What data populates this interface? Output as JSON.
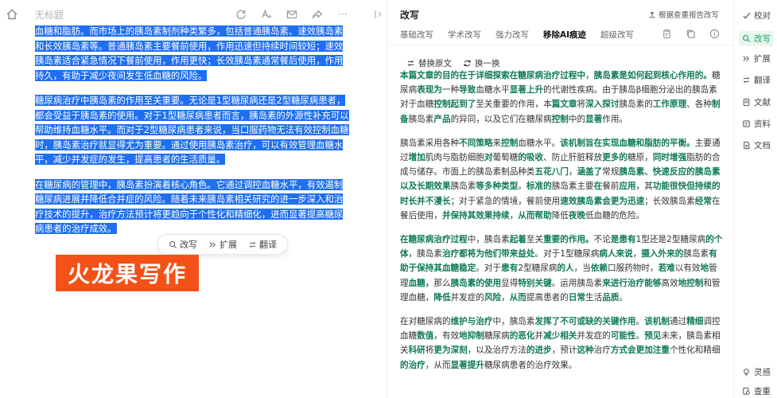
{
  "editor": {
    "title": "无标题",
    "tools": [
      "refresh-icon",
      "font-size-icon",
      "mail-icon",
      "share-icon",
      "more-icon",
      "collapse-icon"
    ],
    "more_label": "···",
    "paragraphs": [
      {
        "segments": [
          "血糖和脂肪。而市场上的胰岛素制剂种类繁多，包括普通胰岛素、速效胰岛素和长效胰岛素等。普通胰岛素主要餐前使用，作用迅速但持续时间较短；速效胰岛素适合紧急情况下餐前使用，作用更快；长效胰岛素通常餐后使用，作用持久，有助于减少夜间发生低血糖的风险。"
        ]
      },
      {
        "segments": [
          "糖尿病治疗中胰岛素的作用至关重要。无论是1型糖尿病还是2型糖尿病患者，都会受益于胰岛素的使用。对于1型糖尿病患者而言，胰岛素的外源性补充可以帮助维持血糖水平。而对于2型糖尿病患者来说，当口服药物无法有效控制血糖时，胰岛素治疗就显得尤为重要。通过使用胰岛素治疗，可以有效管理血糖水平，减少并发症的发生，提高患者的生活质量。"
        ]
      },
      {
        "segments": [
          "在糖尿病的管理中，胰岛素扮演着核心角色。它通过调控血糖水平，有效遏制糖尿病进展并降低合并症的风险。随着未来胰岛素相关研究的进一步深入和治疗技术的提升，治疗方法预计将更趋向于个性化和精细化，进而显著提高糖尿病患者的治疗成效。"
        ]
      }
    ],
    "float_actions": [
      {
        "icon": "rewrite-icon",
        "label": "改写"
      },
      {
        "icon": "expand-icon",
        "label": "扩展"
      },
      {
        "icon": "translate-icon",
        "label": "翻译"
      }
    ],
    "brand_label": "火龙果写作"
  },
  "panel": {
    "title": "改写",
    "report_label": "根据查重报告改写",
    "tabs": [
      {
        "label": "基础改写",
        "active": false
      },
      {
        "label": "学术改写",
        "active": false
      },
      {
        "label": "强力改写",
        "active": false
      },
      {
        "label": "移除AI痕迹",
        "active": true
      },
      {
        "label": "超级改写",
        "active": false
      }
    ],
    "tool_icons": [
      "clipboard-icon",
      "copy-icon",
      "info-icon"
    ],
    "swap_buttons": [
      {
        "icon": "replace-icon",
        "label": "替换原文"
      },
      {
        "icon": "swap-batch-icon",
        "label": "换一换"
      }
    ],
    "paragraphs": [
      {
        "segments": [
          {
            "t": "本篇文章的目的在于详细探索在糖尿病治疗过程中",
            "g": true
          },
          {
            "t": "，",
            "g": false
          },
          {
            "t": "胰岛素是如何起到核心作用的。",
            "g": true
          },
          {
            "t": "糖尿病",
            "g": false
          },
          {
            "t": "表现为",
            "g": true
          },
          {
            "t": "一种",
            "g": false
          },
          {
            "t": "导致",
            "g": true
          },
          {
            "t": "血糖水平",
            "g": false
          },
          {
            "t": "显著上升",
            "g": true
          },
          {
            "t": "的代谢性疾病。由于胰岛β细胞分泌出的胰岛素对于血糖",
            "g": false
          },
          {
            "t": "控制起到了",
            "g": true
          },
          {
            "t": "至关重要的作用，本",
            "g": false
          },
          {
            "t": "篇文章",
            "g": true
          },
          {
            "t": "将",
            "g": false
          },
          {
            "t": "深入探讨",
            "g": true
          },
          {
            "t": "胰岛素的",
            "g": false
          },
          {
            "t": "工作原理",
            "g": true
          },
          {
            "t": "、各种",
            "g": false
          },
          {
            "t": "制备",
            "g": true
          },
          {
            "t": "胰岛素",
            "g": false
          },
          {
            "t": "产品",
            "g": true
          },
          {
            "t": "的异同，以及它们在糖尿病",
            "g": false
          },
          {
            "t": "控制",
            "g": true
          },
          {
            "t": "中的",
            "g": false
          },
          {
            "t": "显著",
            "g": true
          },
          {
            "t": "作用。",
            "g": false
          }
        ]
      },
      {
        "segments": [
          {
            "t": "胰岛素采用各种",
            "g": false
          },
          {
            "t": "不同策略",
            "g": true
          },
          {
            "t": "来",
            "g": false
          },
          {
            "t": "控制",
            "g": true
          },
          {
            "t": "血糖水平。",
            "g": false
          },
          {
            "t": "该机制旨在实现血糖和脂肪的平衡。",
            "g": true
          },
          {
            "t": "主要通过",
            "g": false
          },
          {
            "t": "增加",
            "g": true
          },
          {
            "t": "肌肉与脂肪细胞",
            "g": false
          },
          {
            "t": "对",
            "g": true
          },
          {
            "t": "葡萄糖",
            "g": false
          },
          {
            "t": "的吸收",
            "g": true
          },
          {
            "t": "、防止肝脏释放",
            "g": false
          },
          {
            "t": "更多的",
            "g": true
          },
          {
            "t": "糖原，",
            "g": false
          },
          {
            "t": "同时增强",
            "g": true
          },
          {
            "t": "脂肪的合成与储存。市面上的胰岛素制品种类",
            "g": false
          },
          {
            "t": "五花八门",
            "g": true
          },
          {
            "t": "，",
            "g": false
          },
          {
            "t": "涵盖了",
            "g": true
          },
          {
            "t": "常规",
            "g": false
          },
          {
            "t": "胰岛素、快速反应的胰岛素以及长期效果",
            "g": true
          },
          {
            "t": "胰岛素",
            "g": false
          },
          {
            "t": "等多种类型",
            "g": true
          },
          {
            "t": "。",
            "g": false
          },
          {
            "t": "标准的",
            "g": true
          },
          {
            "t": "胰岛素主要",
            "g": false
          },
          {
            "t": "在",
            "g": true
          },
          {
            "t": "餐前",
            "g": false
          },
          {
            "t": "应用",
            "g": true
          },
          {
            "t": "，其",
            "g": false
          },
          {
            "t": "功能很快但持续的时长并不漫长",
            "g": true
          },
          {
            "t": "；对于紧急的情境，餐前使用",
            "g": false
          },
          {
            "t": "速效胰岛素会更为迅速",
            "g": true
          },
          {
            "t": "；长效胰岛素",
            "g": false
          },
          {
            "t": "经常",
            "g": true
          },
          {
            "t": "在餐后使用，",
            "g": false
          },
          {
            "t": "并保持其效果持续",
            "g": true
          },
          {
            "t": "，",
            "g": false
          },
          {
            "t": "从而帮助",
            "g": true
          },
          {
            "t": "降低",
            "g": false
          },
          {
            "t": "夜晚",
            "g": true
          },
          {
            "t": "低血糖的危险。",
            "g": false
          }
        ]
      },
      {
        "segments": [
          {
            "t": "在糖尿病治疗过程",
            "g": true
          },
          {
            "t": "中，胰岛素",
            "g": false
          },
          {
            "t": "起着",
            "g": true
          },
          {
            "t": "至关",
            "g": false
          },
          {
            "t": "重要的作用。",
            "g": true
          },
          {
            "t": "不论",
            "g": false
          },
          {
            "t": "是患有",
            "g": true
          },
          {
            "t": "1型还是2型糖尿病",
            "g": false
          },
          {
            "t": "的个体",
            "g": true
          },
          {
            "t": "，胰岛素",
            "g": false
          },
          {
            "t": "治疗都将为他们带来益处",
            "g": true
          },
          {
            "t": "。对于1型糖尿病",
            "g": false
          },
          {
            "t": "病人来说",
            "g": true
          },
          {
            "t": "，",
            "g": false
          },
          {
            "t": "摄入外来的",
            "g": true
          },
          {
            "t": "胰岛素",
            "g": false
          },
          {
            "t": "有助于保持其血糖稳定",
            "g": true
          },
          {
            "t": "。对于",
            "g": false
          },
          {
            "t": "患有",
            "g": true
          },
          {
            "t": "2型糖尿病",
            "g": false
          },
          {
            "t": "的人",
            "g": true
          },
          {
            "t": "，当",
            "g": false
          },
          {
            "t": "依赖",
            "g": true
          },
          {
            "t": "口服药物时，",
            "g": false
          },
          {
            "t": "若难",
            "g": true
          },
          {
            "t": "以有效",
            "g": false
          },
          {
            "t": "地",
            "g": true
          },
          {
            "t": "管理",
            "g": false
          },
          {
            "t": "血糖，",
            "g": true
          },
          {
            "t": "那么",
            "g": false
          },
          {
            "t": "胰岛素的使用",
            "g": true
          },
          {
            "t": "显得",
            "g": false
          },
          {
            "t": "特别关键",
            "g": true
          },
          {
            "t": "。运用胰岛素",
            "g": false
          },
          {
            "t": "来进行治疗能够",
            "g": true
          },
          {
            "t": "高效",
            "g": false
          },
          {
            "t": "地控制",
            "g": true
          },
          {
            "t": "和管理血糖，",
            "g": false
          },
          {
            "t": "降低",
            "g": true
          },
          {
            "t": "并发症的",
            "g": false
          },
          {
            "t": "风险",
            "g": true
          },
          {
            "t": "，",
            "g": false
          },
          {
            "t": "从而",
            "g": true
          },
          {
            "t": "提高患者的",
            "g": false
          },
          {
            "t": "日常",
            "g": true
          },
          {
            "t": "生活",
            "g": false
          },
          {
            "t": "品质",
            "g": true
          },
          {
            "t": "。",
            "g": false
          }
        ]
      },
      {
        "segments": [
          {
            "t": "在对糖尿病的",
            "g": false
          },
          {
            "t": "维护与治疗",
            "g": true
          },
          {
            "t": "中，胰岛素",
            "g": false
          },
          {
            "t": "发挥了不可或缺的关键作用",
            "g": true
          },
          {
            "t": "。",
            "g": false
          },
          {
            "t": "该机制",
            "g": true
          },
          {
            "t": "通过",
            "g": false
          },
          {
            "t": "精细",
            "g": true
          },
          {
            "t": "调控血糖",
            "g": false
          },
          {
            "t": "数值",
            "g": true
          },
          {
            "t": "，有效",
            "g": false
          },
          {
            "t": "地抑制",
            "g": true
          },
          {
            "t": "糖尿病",
            "g": false
          },
          {
            "t": "的恶化",
            "g": true
          },
          {
            "t": "并",
            "g": false
          },
          {
            "t": "减少相关",
            "g": true
          },
          {
            "t": "并发症的",
            "g": false
          },
          {
            "t": "可能性",
            "g": true
          },
          {
            "t": "。",
            "g": false
          },
          {
            "t": "预见",
            "g": true
          },
          {
            "t": "未来，胰岛素相关",
            "g": false
          },
          {
            "t": "科研",
            "g": true
          },
          {
            "t": "将",
            "g": false
          },
          {
            "t": "更为深刻",
            "g": true
          },
          {
            "t": "，以及治疗方法",
            "g": false
          },
          {
            "t": "的进步",
            "g": true
          },
          {
            "t": "，预计",
            "g": false
          },
          {
            "t": "这种",
            "g": true
          },
          {
            "t": "治疗",
            "g": false
          },
          {
            "t": "方式会更加注重",
            "g": true
          },
          {
            "t": "个性化和精细",
            "g": false
          },
          {
            "t": "的治疗",
            "g": true
          },
          {
            "t": "，从而",
            "g": false
          },
          {
            "t": "显著提升",
            "g": true
          },
          {
            "t": "糖尿病患者的治疗效果。",
            "g": false
          }
        ]
      }
    ]
  },
  "right_rail": {
    "items": [
      {
        "icon": "proofread-icon",
        "label": "校对",
        "active": false
      },
      {
        "icon": "rewrite-icon",
        "label": "改写",
        "active": true
      },
      {
        "icon": "expand-icon",
        "label": "扩展",
        "active": false
      },
      {
        "icon": "translate-icon",
        "label": "翻译",
        "active": false
      },
      {
        "icon": "literature-icon",
        "label": "文献",
        "active": false
      },
      {
        "icon": "material-icon",
        "label": "资料",
        "active": false
      },
      {
        "icon": "document-icon",
        "label": "文档",
        "active": false
      }
    ],
    "bottom_items": [
      {
        "icon": "inspiration-icon",
        "label": "灵感"
      },
      {
        "icon": "plagiarism-check-icon",
        "label": "查重"
      }
    ]
  }
}
